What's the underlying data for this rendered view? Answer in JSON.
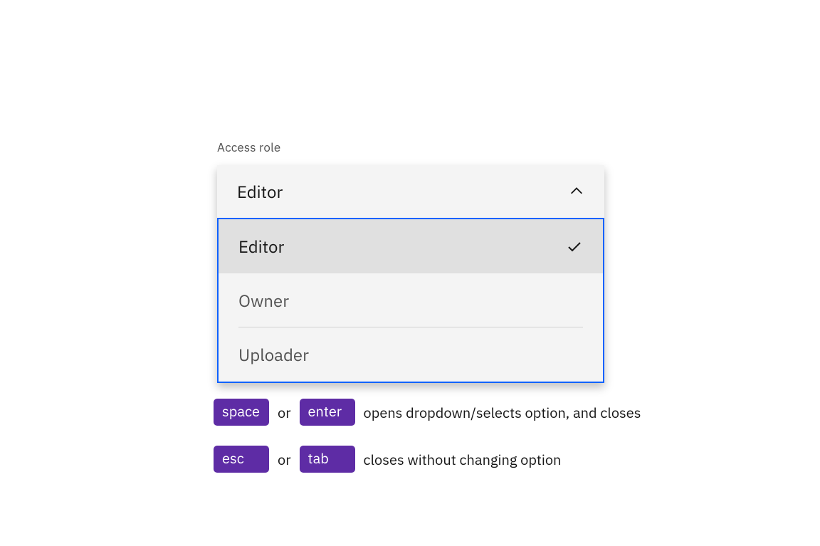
{
  "label": "Access role",
  "dropdown": {
    "selected": "Editor",
    "options": [
      "Editor",
      "Owner",
      "Uploader"
    ]
  },
  "hints": {
    "row1": {
      "key1": "space",
      "or": "or",
      "key2": "enter",
      "text": "opens dropdown/selects option, and closes"
    },
    "row2": {
      "key1": "esc",
      "or": "or",
      "key2": "tab",
      "text": "closes without changing option"
    }
  }
}
